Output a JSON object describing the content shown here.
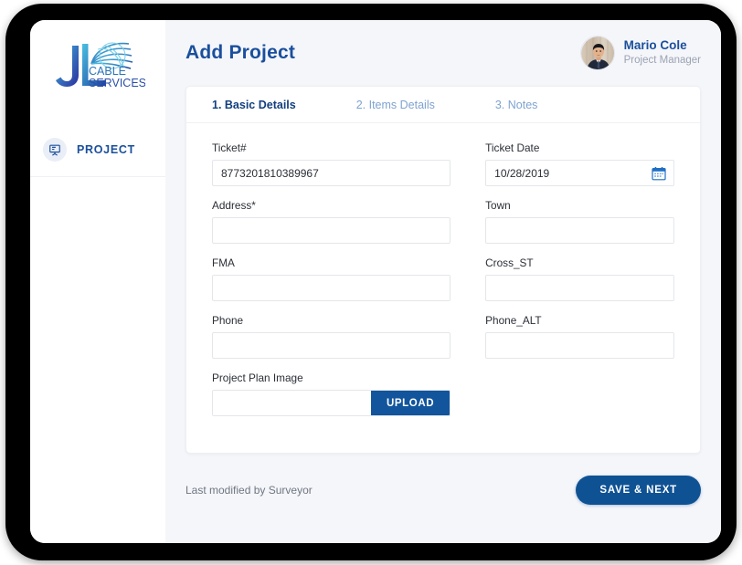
{
  "sidebar": {
    "logo": {
      "letters": "JL",
      "line1": "CABLE",
      "line2": "SERVICES",
      "icon": "fiber-cable-fan-icon"
    },
    "items": [
      {
        "label": "PROJECT",
        "icon": "project-board-icon"
      }
    ]
  },
  "header": {
    "title": "Add Project",
    "user": {
      "name": "Mario Cole",
      "role": "Project Manager",
      "avatar_icon": "user-avatar-photo"
    }
  },
  "tabs": [
    {
      "label": "1. Basic Details",
      "active": true
    },
    {
      "label": "2. Items Details",
      "active": false
    },
    {
      "label": "3. Notes",
      "active": false
    }
  ],
  "form": {
    "fields": [
      {
        "label": "Ticket#",
        "value": "8773201810389967",
        "placeholder": ""
      },
      {
        "label": "Ticket Date",
        "value": "10/28/2019",
        "placeholder": "",
        "icon": "calendar-icon"
      },
      {
        "label": "Address*",
        "value": "",
        "placeholder": ""
      },
      {
        "label": "Town",
        "value": "",
        "placeholder": ""
      },
      {
        "label": "FMA",
        "value": "",
        "placeholder": ""
      },
      {
        "label": "Cross_ST",
        "value": "",
        "placeholder": ""
      },
      {
        "label": "Phone",
        "value": "",
        "placeholder": ""
      },
      {
        "label": "Phone_ALT",
        "value": "",
        "placeholder": ""
      }
    ],
    "upload": {
      "label": "Project Plan Image",
      "value": "",
      "placeholder": "",
      "button_label": "UPLOAD"
    }
  },
  "footer": {
    "last_modified": "Last modified by Surveyor",
    "save_next_label": "SAVE & NEXT"
  },
  "colors": {
    "brand_blue": "#1a4f9c",
    "button_blue": "#0f5294",
    "upload_blue": "#12559c",
    "tab_active": "#123f7e",
    "tab_inactive": "#7fa3cf",
    "page_bg": "#f5f6fa",
    "card_bg": "#ffffff",
    "bezel": "#000000"
  }
}
